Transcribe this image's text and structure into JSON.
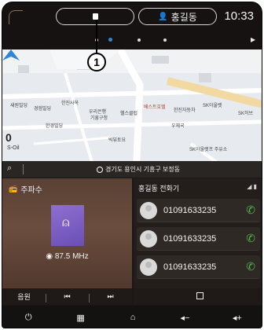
{
  "status_bar": {
    "profile_name": "홍길동",
    "time": "10:33"
  },
  "callout": {
    "label": "1"
  },
  "pager": {
    "pages": 4,
    "active": 1
  },
  "map": {
    "scale_value": "0",
    "scale_unit": "S-Oil",
    "labels": [
      {
        "text": "새원빌딩",
        "color": "normal"
      },
      {
        "text": "경험빌딩",
        "color": "normal"
      },
      {
        "text": "한진사옥",
        "color": "normal"
      },
      {
        "text": "우리은행",
        "color": "normal"
      },
      {
        "text": "기흥구청",
        "color": "normal"
      },
      {
        "text": "헬스클럽",
        "color": "normal"
      },
      {
        "text": "베스트호텔",
        "color": "red"
      },
      {
        "text": "한진자동차",
        "color": "normal"
      },
      {
        "text": "SK아울렛",
        "color": "normal"
      },
      {
        "text": "SK허브",
        "color": "normal"
      },
      {
        "text": "빅뷰토요",
        "color": "normal"
      },
      {
        "text": "한경빌딩",
        "color": "normal"
      },
      {
        "text": "우체국",
        "color": "normal"
      },
      {
        "text": "SK아울렛프 주유소",
        "color": "normal"
      }
    ]
  },
  "search": {
    "address": "경기도 용인시 기흥구 보정동"
  },
  "radio": {
    "title": "주파수",
    "frequency": "87.5 MHz",
    "controls": [
      "음원",
      "⏮",
      "⏭"
    ]
  },
  "phone": {
    "title": "홍길동 전화기",
    "contacts": [
      {
        "number": "01091633235"
      },
      {
        "number": "01091633235"
      },
      {
        "number": "01091633235"
      }
    ]
  },
  "bottom_nav": {
    "items": [
      "⏻",
      "▦",
      "⌂",
      "◂−",
      "◂+"
    ]
  },
  "colors": {
    "accent_blue": "#2d86d6",
    "call_green": "#55b84a",
    "album_purple": "#7a5cc4"
  }
}
